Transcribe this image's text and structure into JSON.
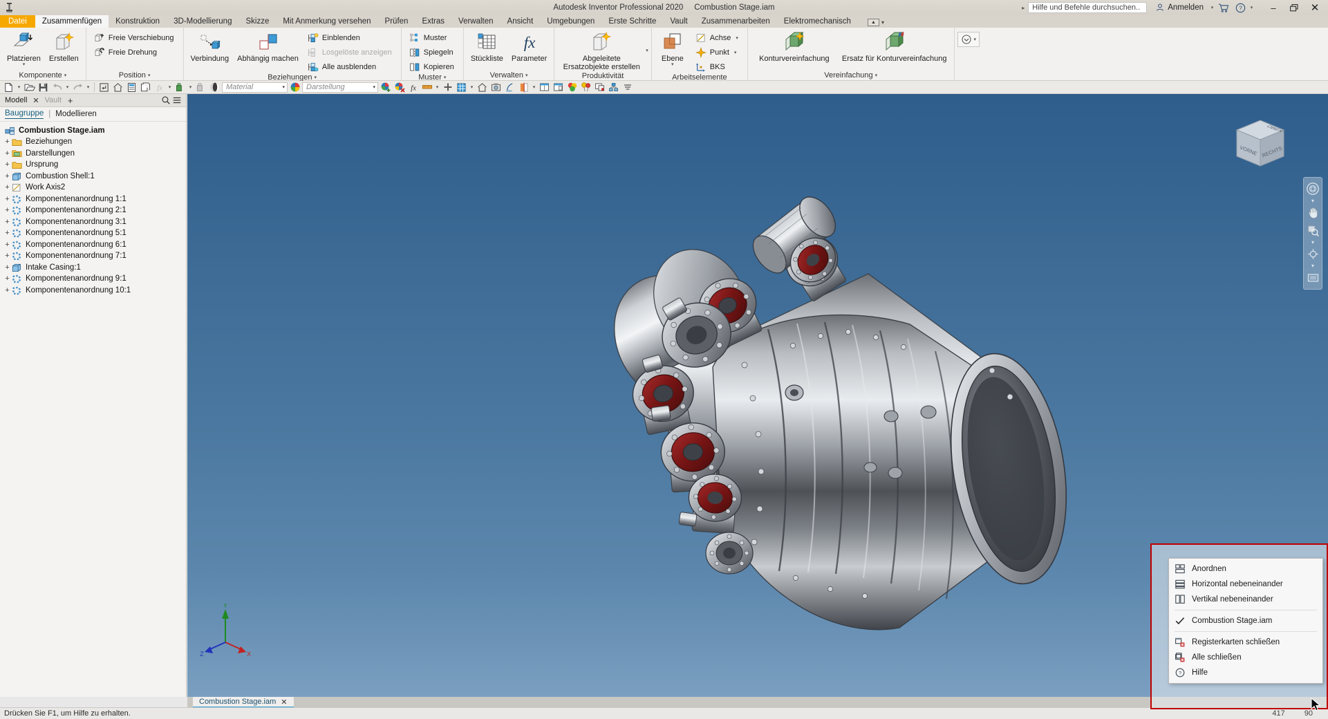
{
  "titlebar": {
    "app_title": "Autodesk Inventor Professional 2020",
    "document_title": "Combustion Stage.iam",
    "help_placeholder": "Hilfe und Befehle durchsuchen..",
    "signin_label": "Anmelden",
    "logo_icon": "inventor-logo-icon",
    "cart_icon": "cart-icon",
    "help_icon": "help-circle-icon",
    "minimize_label": "–",
    "restore_label": "❐",
    "close_label": "✕"
  },
  "ribbon_tabs": {
    "file": "Datei",
    "items": [
      {
        "label": "Zusammenfügen",
        "active": true
      },
      {
        "label": "Konstruktion",
        "active": false
      },
      {
        "label": "3D-Modellierung",
        "active": false
      },
      {
        "label": "Skizze",
        "active": false
      },
      {
        "label": "Mit Anmerkung versehen",
        "active": false
      },
      {
        "label": "Prüfen",
        "active": false
      },
      {
        "label": "Extras",
        "active": false
      },
      {
        "label": "Verwalten",
        "active": false
      },
      {
        "label": "Ansicht",
        "active": false
      },
      {
        "label": "Umgebungen",
        "active": false
      },
      {
        "label": "Erste Schritte",
        "active": false
      },
      {
        "label": "Vault",
        "active": false
      },
      {
        "label": "Zusammenarbeiten",
        "active": false
      },
      {
        "label": "Elektromechanisch",
        "active": false
      }
    ],
    "collapse_icon": "ribbon-collapse-icon"
  },
  "ribbon_panels": [
    {
      "title": "Komponente",
      "has_dropdown": true,
      "big_buttons": [
        {
          "label": "Platzieren",
          "icon": "place-component-icon",
          "has_arrow": true
        },
        {
          "label": "Erstellen",
          "icon": "create-component-icon",
          "has_arrow": false
        }
      ],
      "small_buttons": []
    },
    {
      "title": "Position",
      "has_dropdown": true,
      "big_buttons": [],
      "small_buttons": [
        {
          "label": "Freie Verschiebung",
          "icon": "free-move-icon",
          "disabled": false
        },
        {
          "label": "Freie Drehung",
          "icon": "free-rotate-icon",
          "disabled": false
        }
      ]
    },
    {
      "title": "Beziehungen",
      "has_dropdown": true,
      "big_buttons": [
        {
          "label": "Verbindung",
          "icon": "joint-icon",
          "has_arrow": false
        },
        {
          "label": "Abhängig machen",
          "icon": "constrain-icon",
          "has_arrow": false
        }
      ],
      "small_buttons": [
        {
          "label": "Einblenden",
          "icon": "show-icon",
          "disabled": false
        },
        {
          "label": "Losgelöste anzeigen",
          "icon": "show-sick-icon",
          "disabled": true
        },
        {
          "label": "Alle ausblenden",
          "icon": "hide-all-icon",
          "disabled": false
        }
      ]
    },
    {
      "title": "Muster",
      "has_dropdown": true,
      "big_buttons": [],
      "small_buttons": [
        {
          "label": "Muster",
          "icon": "pattern-icon",
          "disabled": false
        },
        {
          "label": "Spiegeln",
          "icon": "mirror-icon",
          "disabled": false
        },
        {
          "label": "Kopieren",
          "icon": "copy-icon",
          "disabled": false
        }
      ]
    },
    {
      "title": "Verwalten",
      "has_dropdown": true,
      "big_buttons": [
        {
          "label": "Stückliste",
          "icon": "bill-of-materials-icon",
          "has_arrow": false
        },
        {
          "label": "Parameter",
          "icon": "fx-parameter-icon",
          "has_arrow": false
        }
      ],
      "small_buttons": []
    },
    {
      "title": "Produktivität",
      "has_dropdown": false,
      "big_buttons": [
        {
          "label": "Abgeleitete Ersatzobjekte erstellen",
          "icon": "derive-substitute-icon",
          "has_arrow": true
        }
      ],
      "small_buttons": []
    },
    {
      "title": "Arbeitselemente",
      "has_dropdown": false,
      "big_buttons": [
        {
          "label": "Ebene",
          "icon": "work-plane-icon",
          "has_arrow": true
        }
      ],
      "small_buttons": [
        {
          "label": "Achse",
          "icon": "work-axis-icon",
          "disabled": false,
          "has_arrow": true
        },
        {
          "label": "Punkt",
          "icon": "work-point-icon",
          "disabled": false,
          "has_arrow": true
        },
        {
          "label": "BKS",
          "icon": "ucs-icon",
          "disabled": false,
          "has_arrow": false
        }
      ]
    },
    {
      "title": "Vereinfachung",
      "has_dropdown": true,
      "big_buttons": [
        {
          "label": "Konturvereinfachung",
          "icon": "shrinkwrap-icon",
          "has_arrow": false
        },
        {
          "label": "Ersatz für Konturvereinfachung",
          "icon": "shrinkwrap-substitute-icon",
          "has_arrow": false
        }
      ],
      "small_buttons": []
    }
  ],
  "quick_access": {
    "material_placeholder": "Material",
    "appearance_placeholder": "Darstellung",
    "icons": [
      "new-icon",
      "open-icon",
      "save-icon",
      "undo-icon",
      "redo-icon",
      "return-icon",
      "home-icon",
      "update-icon",
      "copy-clipboard-icon",
      "fx-icon",
      "measure-icon",
      "select-icon",
      "material-sphere-icon"
    ],
    "right_icons": [
      "appearance-add-icon",
      "appearance-clear-icon",
      "fx-icon",
      "section-icon",
      "add-icon",
      "grid-icon",
      "home-view-icon",
      "camera-icon",
      "shadow-icon",
      "halfsection-icon",
      "tile-window-icon",
      "new-window-icon",
      "colors-icon",
      "balloon-icon",
      "arrange-icon",
      "component-icon",
      "more-icon"
    ]
  },
  "browser": {
    "tabs": [
      {
        "label": "Modell",
        "active": true
      },
      {
        "label": "Vault",
        "active": false
      }
    ],
    "close_icon": "close-icon",
    "add_icon": "add-tab-icon",
    "search_icon": "search-icon",
    "menu_icon": "hamburger-menu-icon",
    "sub_bar": {
      "active": "Baugruppe",
      "divider": "|",
      "other": "Modellieren"
    },
    "tree": [
      {
        "label": "Combustion Stage.iam",
        "icon": "assembly-icon",
        "expand": "",
        "root": true,
        "indent": 0
      },
      {
        "label": "Beziehungen",
        "icon": "folder-icon",
        "expand": "+",
        "root": false,
        "indent": 1
      },
      {
        "label": "Darstellungen",
        "icon": "representations-folder-icon",
        "expand": "+",
        "root": false,
        "indent": 1
      },
      {
        "label": "Ursprung",
        "icon": "folder-icon",
        "expand": "+",
        "root": false,
        "indent": 1
      },
      {
        "label": "Combustion Shell:1",
        "icon": "part-icon",
        "expand": "+",
        "root": false,
        "indent": 1
      },
      {
        "label": "Work Axis2",
        "icon": "work-axis-icon",
        "expand": "+",
        "root": false,
        "indent": 1
      },
      {
        "label": "Komponentenanordnung 1:1",
        "icon": "component-pattern-icon",
        "expand": "+",
        "root": false,
        "indent": 1
      },
      {
        "label": "Komponentenanordnung 2:1",
        "icon": "component-pattern-icon",
        "expand": "+",
        "root": false,
        "indent": 1
      },
      {
        "label": "Komponentenanordnung 3:1",
        "icon": "component-pattern-icon",
        "expand": "+",
        "root": false,
        "indent": 1
      },
      {
        "label": "Komponentenanordnung 5:1",
        "icon": "component-pattern-icon",
        "expand": "+",
        "root": false,
        "indent": 1
      },
      {
        "label": "Komponentenanordnung 6:1",
        "icon": "component-pattern-icon",
        "expand": "+",
        "root": false,
        "indent": 1
      },
      {
        "label": "Komponentenanordnung 7:1",
        "icon": "component-pattern-icon",
        "expand": "+",
        "root": false,
        "indent": 1
      },
      {
        "label": "Intake Casing:1",
        "icon": "part-icon",
        "expand": "+",
        "root": false,
        "indent": 1
      },
      {
        "label": "Komponentenanordnung 9:1",
        "icon": "component-pattern-icon",
        "expand": "+",
        "root": false,
        "indent": 1
      },
      {
        "label": "Komponentenanordnung 10:1",
        "icon": "component-pattern-icon",
        "expand": "+",
        "root": false,
        "indent": 1
      }
    ]
  },
  "viewport": {
    "viewcube": {
      "top_face": "OBEN",
      "front_face": "VORNE",
      "right_face": "RECHTS"
    },
    "nav_icons": [
      "full-navigation-wheel-icon",
      "pan-hand-icon",
      "zoom-icon",
      "orbit-icon",
      "look-at-icon"
    ],
    "axis_labels": {
      "x": "X",
      "y": "Y",
      "z": "Z"
    },
    "axis_colors": {
      "x": "#cc2222",
      "y": "#22aa22",
      "z": "#2233cc"
    },
    "background_top": "#2f5d8c",
    "background_bottom": "#7a9fc0",
    "model_name": "Combustion Stage turbine assembly"
  },
  "document_tabs": [
    {
      "label": "Combustion Stage.iam",
      "active": true,
      "close_icon": "close-icon"
    }
  ],
  "statusbar": {
    "message": "Drücken Sie F1, um Hilfe zu erhalten.",
    "value_1": "417",
    "value_2": "90"
  },
  "context_menu": {
    "items": [
      {
        "label": "Anordnen",
        "icon": "arrange-icon",
        "checked": false,
        "separator_after": false
      },
      {
        "label": "Horizontal nebeneinander",
        "icon": "tile-horizontal-icon",
        "checked": false,
        "separator_after": false
      },
      {
        "label": "Vertikal nebeneinander",
        "icon": "tile-vertical-icon",
        "checked": false,
        "separator_after": true
      },
      {
        "label": "Combustion Stage.iam",
        "icon": "check-icon",
        "checked": true,
        "separator_after": true
      },
      {
        "label": "Registerkarten schließen",
        "icon": "close-tabs-icon",
        "checked": false,
        "separator_after": false
      },
      {
        "label": "Alle schließen",
        "icon": "close-all-icon",
        "checked": false,
        "separator_after": false
      },
      {
        "label": "Hilfe",
        "icon": "help-circle-icon",
        "checked": false,
        "separator_after": false
      }
    ],
    "highlight_color": "#c00000"
  }
}
